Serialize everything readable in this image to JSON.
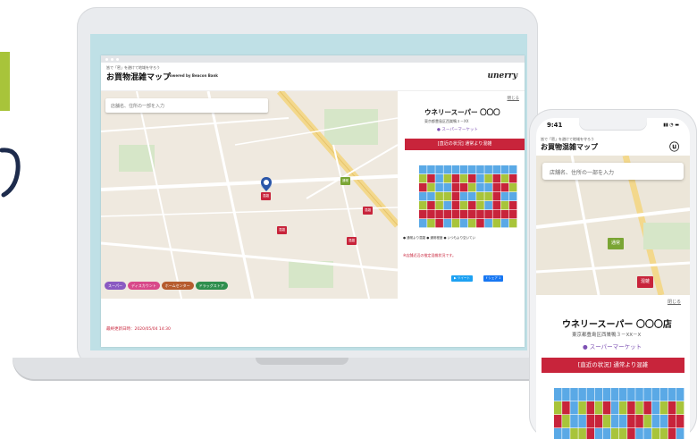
{
  "laptop": {
    "tagline": "皆で「密」を避けて地域を守ろう",
    "title": "お買物混雑マップ",
    "powered": "Powered by Beacon Bank",
    "logo": "unerry",
    "search_placeholder": "店舗名、住所の一部を入力",
    "map_labels": [
      "混雑",
      "混雑",
      "通常",
      "混雑",
      "混雑"
    ],
    "chips": [
      {
        "label": "スーパー",
        "color": "#8a5ac2"
      },
      {
        "label": "ディスカウント",
        "color": "#d8498a"
      },
      {
        "label": "ホームセンター",
        "color": "#b65c2e"
      },
      {
        "label": "ドラッグストア",
        "color": "#2f8f4e"
      }
    ],
    "updated": "最終更新日時：2020/05/04 14:30",
    "panel": {
      "close": "閉じる",
      "store_name": "ウネリースーパー 〇〇〇",
      "address": "東京都豊島区西巣鴨３－XX",
      "category": "スーパーマーケット",
      "status": "[直近の状況] 通常より混雑",
      "legend": "● 通常より混雑 ● 通常程度 ● いつもより空いてい",
      "note": "※店舗近辺の推定混雑状況です。",
      "share_tweet": "ツイート",
      "share_fb": "シェア 1"
    }
  },
  "phone": {
    "time": "9:41",
    "tagline": "皆で「密」を避けて地域を守ろう",
    "title": "お買物混雑マップ",
    "logo": "unerry",
    "search_placeholder": "店舗名、住所の一部を入力",
    "map_labels": [
      "通常",
      "混雑"
    ],
    "close": "閉じる",
    "store_name": "ウネリースーパー 〇〇〇店",
    "address": "東京都豊島区西巣鴨３－XX－X",
    "category": "スーパーマーケット",
    "status": "[直近の状況] 通常より混雑"
  },
  "colors": {
    "busy": "#c8243b",
    "normal": "#a8c43a",
    "empty": "#5aa9e6",
    "accent_purple": "#7d51b3"
  },
  "icons": [
    "search-icon",
    "location-pin-icon",
    "store-icon",
    "twitter-icon",
    "facebook-icon"
  ]
}
